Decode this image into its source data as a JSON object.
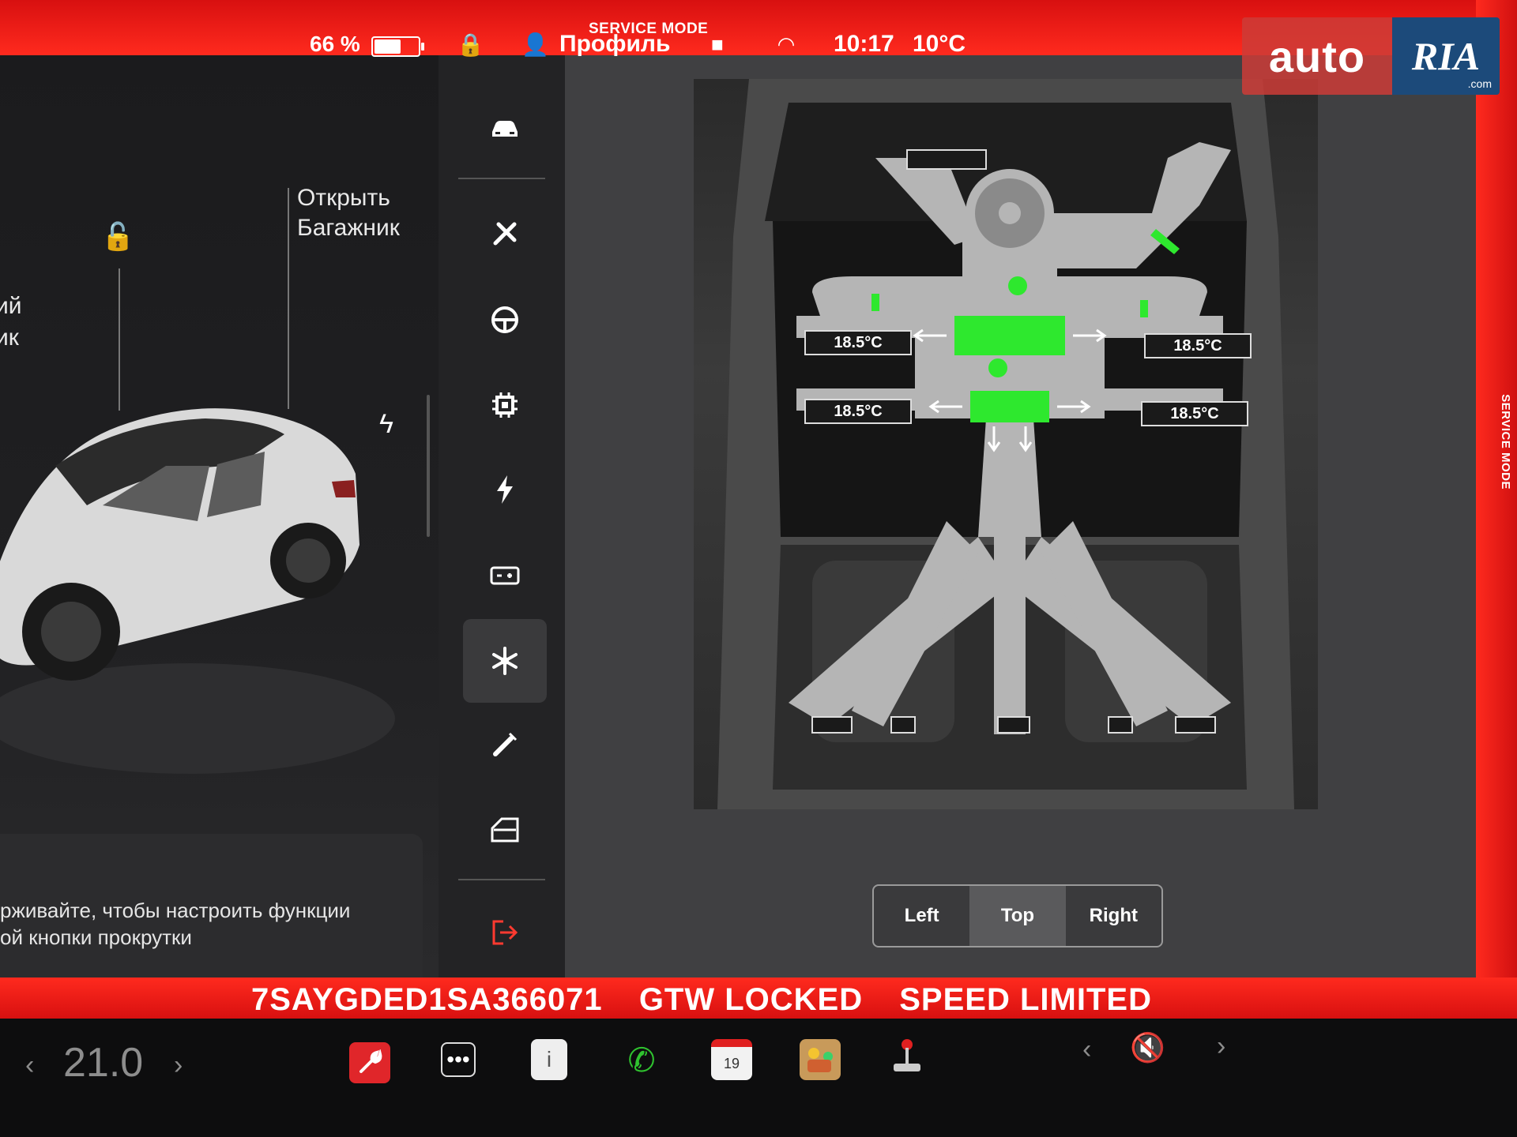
{
  "status_bar": {
    "battery_percent_text": "66 %",
    "battery_level": 0.66,
    "service_mode": "SERVICE MODE",
    "profile": "Профиль",
    "time": "10:17",
    "outside_temp": "10°C"
  },
  "watermark": {
    "left": "auto",
    "right": "RIA",
    "suffix": ".com"
  },
  "vehicle": {
    "trunk_label_line1": "Открыть",
    "trunk_label_line2": "Багажник",
    "frunk_label_line1": "ий",
    "frunk_label_line2": "ик",
    "hint_line1": "рживайте, чтобы настроить функции",
    "hint_line2": "ой кнопки прокрутки"
  },
  "nav": {
    "items": [
      {
        "name": "car",
        "glyph": "🚘"
      },
      {
        "name": "tools",
        "glyph": "🛠"
      },
      {
        "name": "steering",
        "glyph": "⊖"
      },
      {
        "name": "chip",
        "glyph": "⚙"
      },
      {
        "name": "power",
        "glyph": "⚡"
      },
      {
        "name": "battery",
        "glyph": "▭"
      },
      {
        "name": "thermal",
        "glyph": "❄",
        "active": true
      },
      {
        "name": "injector",
        "glyph": "✎"
      },
      {
        "name": "door",
        "glyph": "▱"
      },
      {
        "name": "exit",
        "glyph": "⇥"
      }
    ]
  },
  "thermal": {
    "temps": [
      "18.5°C",
      "18.5°C",
      "18.5°C",
      "18.5°C"
    ],
    "active_color": "#2ee82e",
    "view_options": [
      "Left",
      "Top",
      "Right"
    ],
    "view_selected": "Top"
  },
  "footer_strip": {
    "vin": "7SAYGDED1SA366071",
    "gtw": "GTW LOCKED",
    "speed": "SPEED LIMITED"
  },
  "taskbar": {
    "temperature": "21.0",
    "calendar_day": "19"
  },
  "colors": {
    "service_red": "#ff2a1e",
    "accent_green": "#2ee82e"
  }
}
